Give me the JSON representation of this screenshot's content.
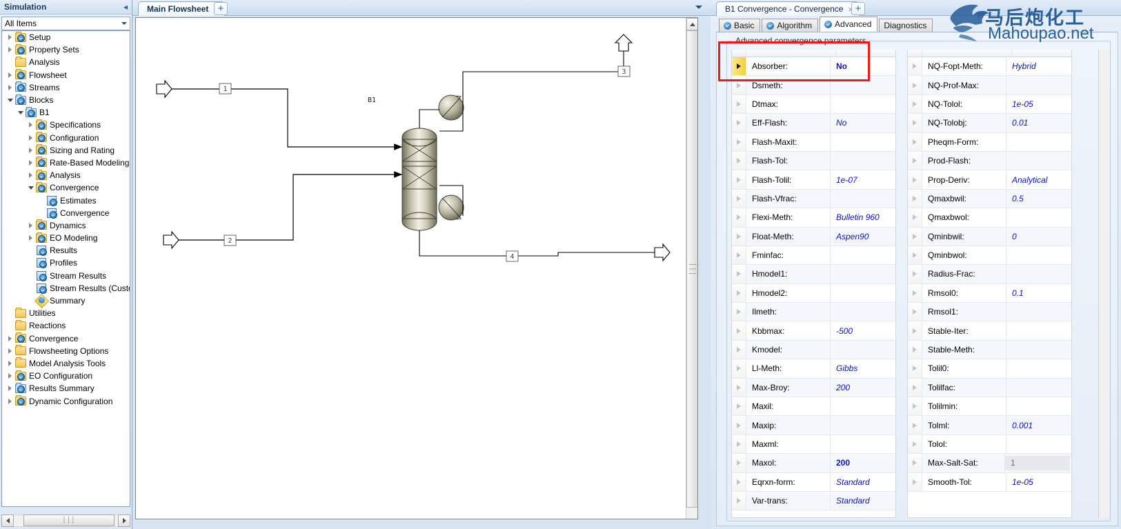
{
  "window": {
    "watermark_cn": "马后炮化工",
    "watermark_url": "Mahoupao.net"
  },
  "sidebar": {
    "title": "Simulation",
    "collapse_icon": "chevron-left-icon",
    "filter_value": "All Items",
    "items": [
      {
        "label": "Setup",
        "indent": 0,
        "icon": "folder-check",
        "expander": "closed"
      },
      {
        "label": "Property Sets",
        "indent": 0,
        "icon": "folder-check",
        "expander": "closed"
      },
      {
        "label": "Analysis",
        "indent": 0,
        "icon": "folder",
        "expander": "none"
      },
      {
        "label": "Flowsheet",
        "indent": 0,
        "icon": "folder-check",
        "expander": "closed"
      },
      {
        "label": "Streams",
        "indent": 0,
        "icon": "folder-blue-check",
        "expander": "closed"
      },
      {
        "label": "Blocks",
        "indent": 0,
        "icon": "folder-blue-check",
        "expander": "open"
      },
      {
        "label": "B1",
        "indent": 1,
        "icon": "folder-blue-check",
        "expander": "open"
      },
      {
        "label": "Specifications",
        "indent": 2,
        "icon": "folder-check",
        "expander": "closed"
      },
      {
        "label": "Configuration",
        "indent": 2,
        "icon": "folder-check",
        "expander": "closed"
      },
      {
        "label": "Sizing and Rating",
        "indent": 2,
        "icon": "folder-check",
        "expander": "closed"
      },
      {
        "label": "Rate-Based Modeling",
        "indent": 2,
        "icon": "folder-check",
        "expander": "closed"
      },
      {
        "label": "Analysis",
        "indent": 2,
        "icon": "folder-check",
        "expander": "closed"
      },
      {
        "label": "Convergence",
        "indent": 2,
        "icon": "folder-check",
        "expander": "open"
      },
      {
        "label": "Estimates",
        "indent": 3,
        "icon": "sheet-check",
        "expander": "none"
      },
      {
        "label": "Convergence",
        "indent": 3,
        "icon": "sheet-check",
        "expander": "none"
      },
      {
        "label": "Dynamics",
        "indent": 2,
        "icon": "folder-check",
        "expander": "closed"
      },
      {
        "label": "EO Modeling",
        "indent": 2,
        "icon": "folder-check",
        "expander": "closed"
      },
      {
        "label": "Results",
        "indent": 2,
        "icon": "sheet-blue-check",
        "expander": "none"
      },
      {
        "label": "Profiles",
        "indent": 2,
        "icon": "sheet-blue-check",
        "expander": "none"
      },
      {
        "label": "Stream Results",
        "indent": 2,
        "icon": "sheet-blue-check",
        "expander": "none"
      },
      {
        "label": "Stream Results (Custor",
        "indent": 2,
        "icon": "sheet-blue-check",
        "expander": "none"
      },
      {
        "label": "Summary",
        "indent": 2,
        "icon": "diamond-check",
        "expander": "none"
      },
      {
        "label": "Utilities",
        "indent": 0,
        "icon": "folder",
        "expander": "none"
      },
      {
        "label": "Reactions",
        "indent": 0,
        "icon": "folder",
        "expander": "none"
      },
      {
        "label": "Convergence",
        "indent": 0,
        "icon": "folder-check",
        "expander": "closed"
      },
      {
        "label": "Flowsheeting Options",
        "indent": 0,
        "icon": "folder",
        "expander": "closed"
      },
      {
        "label": "Model Analysis Tools",
        "indent": 0,
        "icon": "folder",
        "expander": "closed"
      },
      {
        "label": "EO Configuration",
        "indent": 0,
        "icon": "folder-check",
        "expander": "closed"
      },
      {
        "label": "Results Summary",
        "indent": 0,
        "icon": "folder-blue-check",
        "expander": "closed"
      },
      {
        "label": "Dynamic Configuration",
        "indent": 0,
        "icon": "folder-check",
        "expander": "closed"
      }
    ]
  },
  "flowsheet": {
    "tab_label": "Main Flowsheet",
    "tab_close": "×",
    "new_tab": "+",
    "block_label": "B1",
    "stream_labels": [
      "1",
      "2",
      "3",
      "4"
    ]
  },
  "right_panel": {
    "tab_label": "B1 Convergence - Convergence",
    "tab_close": "×",
    "new_tab": "+",
    "subtabs": [
      {
        "label": "Basic",
        "checked": true,
        "active": false
      },
      {
        "label": "Algorithm",
        "checked": true,
        "active": false
      },
      {
        "label": "Advanced",
        "checked": true,
        "active": true
      },
      {
        "label": "Diagnostics",
        "checked": false,
        "active": false
      }
    ],
    "group_title": "Advanced convergence parameters",
    "left_table": [
      {
        "name": "Absorber:",
        "value": "No",
        "style": "bold",
        "current": true
      },
      {
        "name": "Dsmeth:",
        "value": "",
        "style": "italic",
        "current": false
      },
      {
        "name": "Dtmax:",
        "value": "",
        "style": "italic",
        "current": false
      },
      {
        "name": "Eff-Flash:",
        "value": "No",
        "style": "italic",
        "current": false
      },
      {
        "name": "Flash-Maxit:",
        "value": "",
        "style": "italic",
        "current": false
      },
      {
        "name": "Flash-Tol:",
        "value": "",
        "style": "italic",
        "current": false
      },
      {
        "name": "Flash-Tolil:",
        "value": "1e-07",
        "style": "italic",
        "current": false
      },
      {
        "name": "Flash-Vfrac:",
        "value": "",
        "style": "italic",
        "current": false
      },
      {
        "name": "Flexi-Meth:",
        "value": "Bulletin 960",
        "style": "italic",
        "current": false
      },
      {
        "name": "Float-Meth:",
        "value": "Aspen90",
        "style": "italic",
        "current": false
      },
      {
        "name": "Fminfac:",
        "value": "",
        "style": "italic",
        "current": false
      },
      {
        "name": "Hmodel1:",
        "value": "",
        "style": "italic",
        "current": false
      },
      {
        "name": "Hmodel2:",
        "value": "",
        "style": "italic",
        "current": false
      },
      {
        "name": "Ilmeth:",
        "value": "",
        "style": "italic",
        "current": false
      },
      {
        "name": "Kbbmax:",
        "value": "-500",
        "style": "italic",
        "current": false
      },
      {
        "name": "Kmodel:",
        "value": "",
        "style": "italic",
        "current": false
      },
      {
        "name": "Ll-Meth:",
        "value": "Gibbs",
        "style": "italic",
        "current": false
      },
      {
        "name": "Max-Broy:",
        "value": "200",
        "style": "italic",
        "current": false
      },
      {
        "name": "Maxil:",
        "value": "",
        "style": "italic",
        "current": false
      },
      {
        "name": "Maxip:",
        "value": "",
        "style": "italic",
        "current": false
      },
      {
        "name": "Maxml:",
        "value": "",
        "style": "italic",
        "current": false
      },
      {
        "name": "Maxol:",
        "value": "200",
        "style": "bold",
        "current": false
      },
      {
        "name": "Eqrxn-form:",
        "value": "Standard",
        "style": "italic",
        "current": false
      },
      {
        "name": "Var-trans:",
        "value": "Standard",
        "style": "italic",
        "current": false
      }
    ],
    "right_table": [
      {
        "name": "NQ-Fopt-Meth:",
        "value": "Hybrid",
        "style": "italic"
      },
      {
        "name": "NQ-Prof-Max:",
        "value": "",
        "style": "italic"
      },
      {
        "name": "NQ-Tolol:",
        "value": "1e-05",
        "style": "italic"
      },
      {
        "name": "NQ-Tolobj:",
        "value": "0.01",
        "style": "italic"
      },
      {
        "name": "Pheqm-Form:",
        "value": "",
        "style": "italic"
      },
      {
        "name": "Prod-Flash:",
        "value": "",
        "style": "italic"
      },
      {
        "name": "Prop-Deriv:",
        "value": "Analytical",
        "style": "italic"
      },
      {
        "name": "Qmaxbwil:",
        "value": "0.5",
        "style": "italic"
      },
      {
        "name": "Qmaxbwol:",
        "value": "",
        "style": "italic"
      },
      {
        "name": "Qminbwil:",
        "value": "0",
        "style": "italic"
      },
      {
        "name": "Qminbwol:",
        "value": "",
        "style": "italic"
      },
      {
        "name": "Radius-Frac:",
        "value": "",
        "style": "italic"
      },
      {
        "name": "Rmsol0:",
        "value": "0.1",
        "style": "italic"
      },
      {
        "name": "Rmsol1:",
        "value": "",
        "style": "italic"
      },
      {
        "name": "Stable-Iter:",
        "value": "",
        "style": "italic"
      },
      {
        "name": "Stable-Meth:",
        "value": "",
        "style": "italic"
      },
      {
        "name": "Tolil0:",
        "value": "",
        "style": "italic"
      },
      {
        "name": "Tolilfac:",
        "value": "",
        "style": "italic"
      },
      {
        "name": "Tolilmin:",
        "value": "",
        "style": "italic"
      },
      {
        "name": "Tolml:",
        "value": "0.001",
        "style": "italic"
      },
      {
        "name": "Tolol:",
        "value": "",
        "style": "italic"
      },
      {
        "name": "Max-Salt-Sat:",
        "value": "1",
        "style": "readonly"
      },
      {
        "name": "Smooth-Tol:",
        "value": "1e-05",
        "style": "italic"
      }
    ]
  },
  "colors": {
    "accent": "#0b12c8",
    "highlight_box": "#ef1b1b",
    "current_row": "#f6cf3f",
    "watermark": "#2a6099"
  }
}
